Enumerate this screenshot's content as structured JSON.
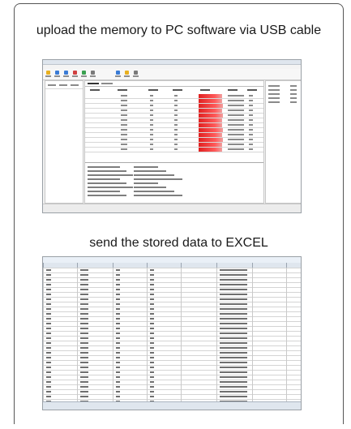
{
  "captions": {
    "upload": "upload the memory to PC software via USB cable",
    "excel": "send the stored data to EXCEL"
  },
  "software_screenshot": {
    "content": "data-logger PC software window with toolbar, device list, data table with red level bars, and log panel",
    "red_bar_fill": [
      0.92,
      0.9,
      0.93,
      0.91,
      0.95,
      0.9,
      0.92,
      0.94,
      0.91,
      0.93,
      0.9,
      0.92
    ]
  },
  "excel_screenshot": {
    "content": "spreadsheet of exported readings"
  },
  "colors": {
    "frame_border": "#555555",
    "bar_red": "#e02020",
    "sheet_grid": "#d4d4d4"
  }
}
